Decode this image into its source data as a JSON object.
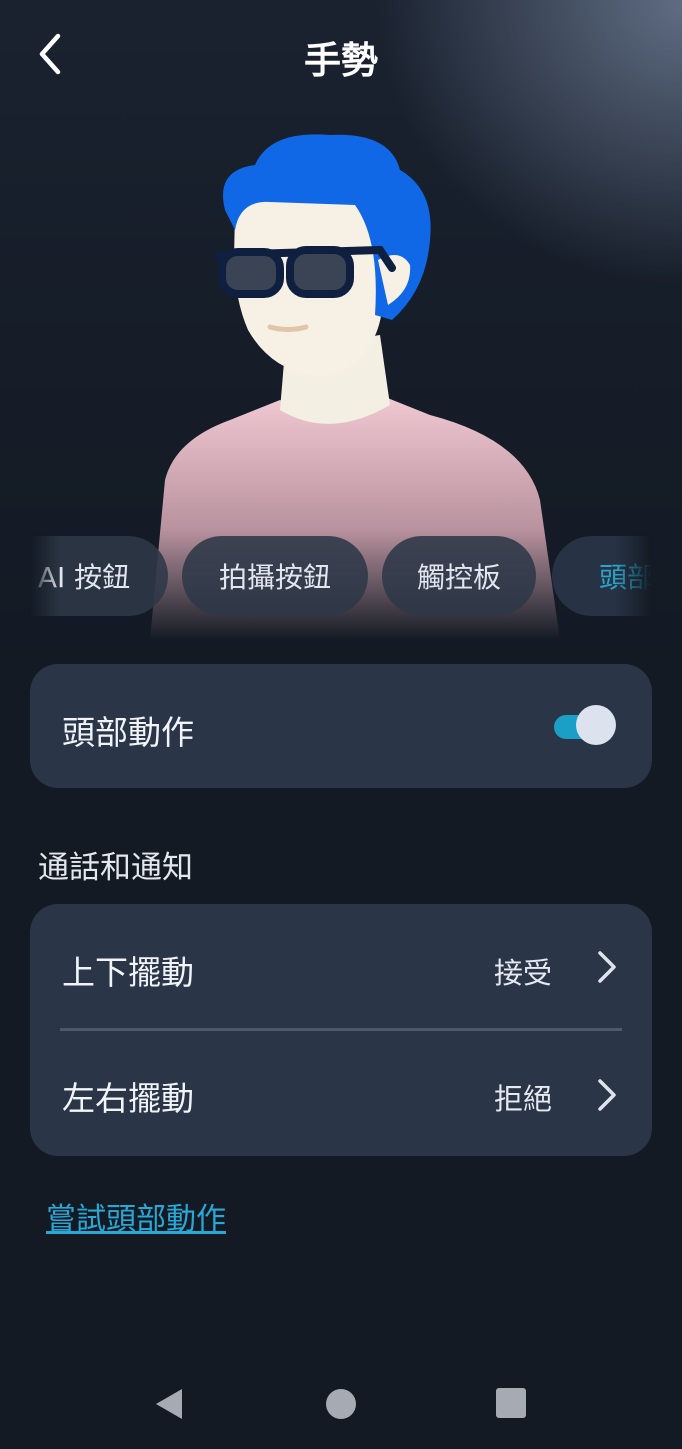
{
  "header": {
    "title": "手勢"
  },
  "tabs": [
    {
      "label": "AI 按鈕",
      "active": false
    },
    {
      "label": "拍攝按鈕",
      "active": false
    },
    {
      "label": "觸控板",
      "active": false
    },
    {
      "label": "頭部",
      "active": true
    }
  ],
  "head_gestures": {
    "label": "頭部動作",
    "enabled": true
  },
  "section": {
    "title": "通話和通知"
  },
  "gesture_rows": [
    {
      "label": "上下擺動",
      "value": "接受"
    },
    {
      "label": "左右擺動",
      "value": "拒絕"
    }
  ],
  "try_link": "嘗試頭部動作",
  "colors": {
    "accent": "#1c9fc6",
    "link": "#27a8d6",
    "card": "#2a3548",
    "background": "#131a24"
  },
  "icons": {
    "back": "chevron-left-icon",
    "row_arrow": "chevron-right-icon"
  }
}
